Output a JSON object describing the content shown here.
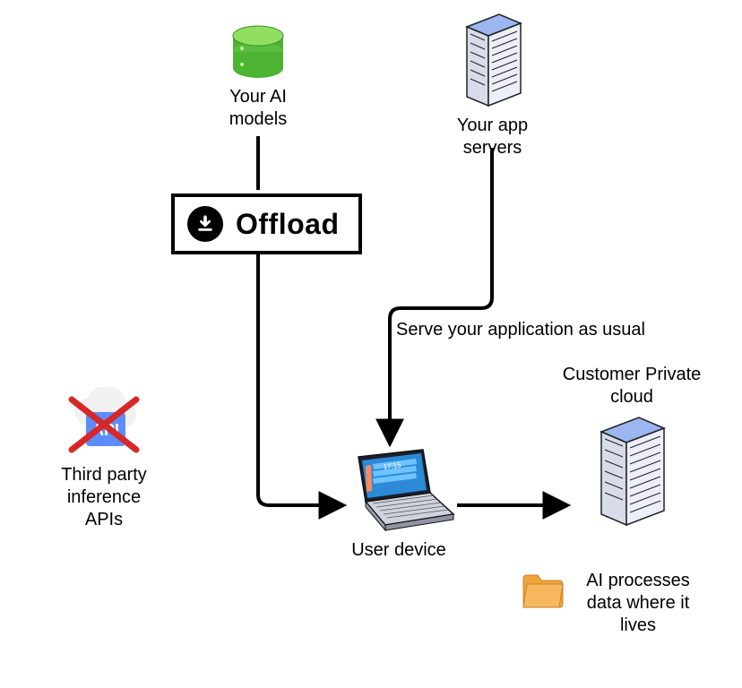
{
  "diagram": {
    "offload_label": "Offload",
    "nodes": {
      "ai_models": "Your AI\nmodels",
      "app_servers": "Your app\nservers",
      "third_party": "Third party\ninference\nAPIs",
      "user_device": "User device",
      "customer_cloud": "Customer Private\ncloud"
    },
    "annotations": {
      "serve": "Serve your application as usual",
      "processes": "AI processes\ndata where it\nlives"
    },
    "icons": {
      "database": "database-icon",
      "server": "server-icon",
      "laptop": "laptop-icon",
      "cloud_api": "cloud-api-icon",
      "crossed_out": "red-x-icon",
      "folder": "folder-icon",
      "download_arrow": "download-arrow-icon"
    },
    "colors": {
      "db_green_top": "#7cd64a",
      "db_green_body": "#4db333",
      "server_blue": "#9bb6f0",
      "server_body": "#e6e9f2",
      "laptop_screen": "#2c8ad6",
      "api_blue": "#5c8cff",
      "folder_orange": "#f1a33c",
      "red_x": "#d62828",
      "arrow": "#000000"
    }
  }
}
